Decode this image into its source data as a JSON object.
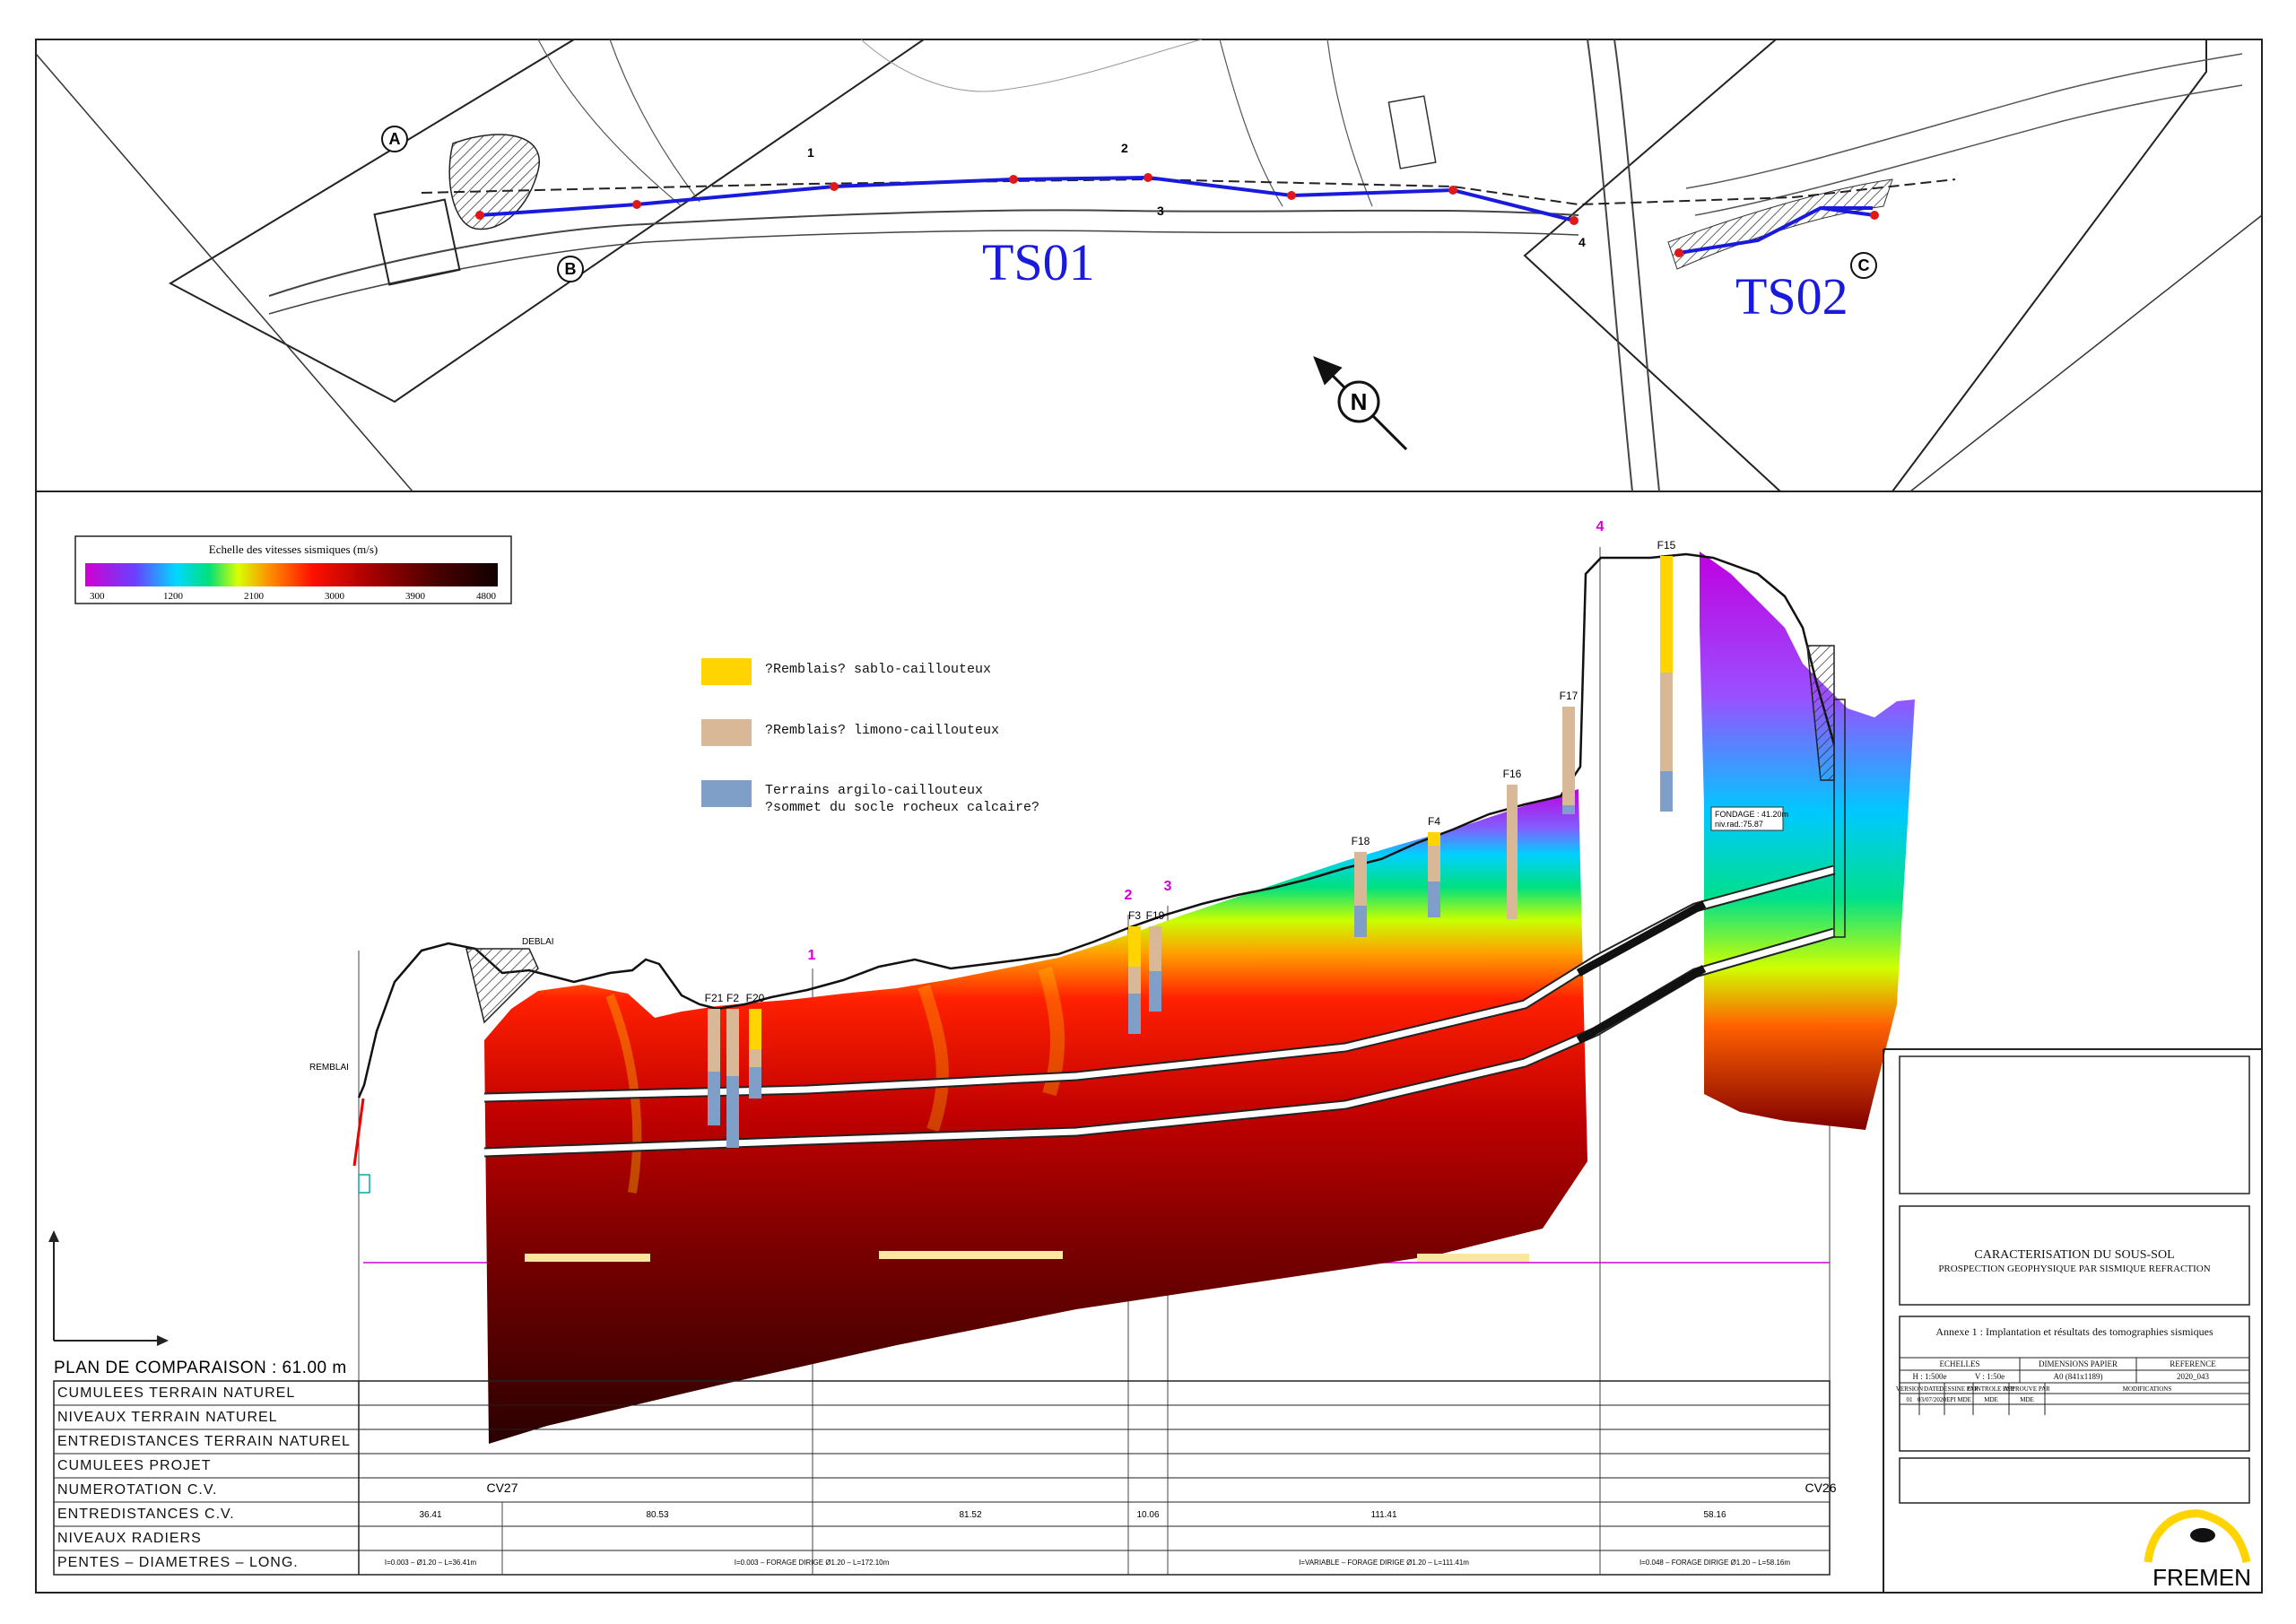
{
  "plan": {
    "profile_labels": [
      "TS01",
      "TS02"
    ],
    "north_label": "N",
    "section_letters": [
      "A",
      "B",
      "C"
    ],
    "profile_markers": [
      "1",
      "2",
      "3",
      "4"
    ]
  },
  "velocity_scale": {
    "title": "Echelle des vitesses sismiques (m/s)",
    "ticks": [
      "300",
      "1200",
      "2100",
      "3000",
      "3900",
      "4800"
    ],
    "colors": [
      "#d000d0",
      "#7a3cff",
      "#2f7dff",
      "#00d8ff",
      "#00e07a",
      "#9cff00",
      "#ffe600",
      "#ff7a00",
      "#ff1000",
      "#b00000",
      "#5a0000",
      "#1a0000"
    ]
  },
  "lithology_legend": [
    {
      "label": "?Remblais? sablo-caillouteux",
      "color": "#ffd400"
    },
    {
      "label": "?Remblais? limono-caillouteux",
      "color": "#d8b896"
    },
    {
      "label": "Terrains argilo-caillouteux\n?sommet du socle rocheux calcaire?",
      "color": "#7f9fc8"
    }
  ],
  "boreholes": [
    "F21",
    "F2",
    "F20",
    "F3",
    "F19",
    "F18",
    "F4",
    "F16",
    "F17",
    "F15"
  ],
  "section_annotations": {
    "remblai": "REMBLAI",
    "deblai": "DEBLAI",
    "fondage": "FONDAGE : 41.20m",
    "niv_rad": "niv.rad.:75.87"
  },
  "datum": "PLAN DE COMPARAISON : 61.00 m",
  "profile_rows": [
    "CUMULEES TERRAIN NATUREL",
    "NIVEAUX TERRAIN NATUREL",
    "ENTREDISTANCES TERRAIN NATUREL",
    "CUMULEES PROJET",
    "NUMEROTATION C.V.",
    "ENTREDISTANCES C.V.",
    "NIVEAUX RADIERS",
    "PENTES  –  DIAMETRES  –  LONG."
  ],
  "cv_labels": [
    "CV27",
    "CV26"
  ],
  "cv_distances": [
    "36.41",
    "80.53",
    "81.52",
    "10.06",
    "111.41",
    "58.16"
  ],
  "pipe_texts": [
    "I=0.003 – Ø1.20 – L=36.41m",
    "I=0.003 – FORAGE DIRIGE Ø1.20 – L=172.10m",
    "I=VARIABLE – FORAGE DIRIGE Ø1.20 – L=111.41m",
    "I=0.048 – FORAGE DIRIGE Ø1.20 – L=58.16m"
  ],
  "title_block": {
    "title": "CARACTERISATION DU SOUS-SOL",
    "subtitle": "PROSPECTION GEOPHYSIQUE PAR SISMIQUE REFRACTION",
    "annexe": "Annexe 1 : Implantation et résultats des tomographies sismiques",
    "table_headers": [
      "ECHELLES",
      "DIMENSIONS PAPIER",
      "REFERENCE"
    ],
    "scales": [
      "H : 1:500e",
      "V : 1:50e"
    ],
    "paper": "A0 (841x1189)",
    "reference": "2020_043",
    "rev_headers": [
      "VERSION",
      "DATE",
      "DESSINE PAR",
      "CONTROLE PAR",
      "APPROUVE PAR",
      "MODIFICATIONS"
    ],
    "rev_row": [
      "01",
      "03/07/2020",
      "EPI MDE",
      "MDE",
      "MDE",
      ""
    ],
    "company": "FREMEN"
  },
  "colors": {
    "frame": "#222222",
    "magenta": "#d400d4",
    "profile_blue": "#1a1adc"
  }
}
